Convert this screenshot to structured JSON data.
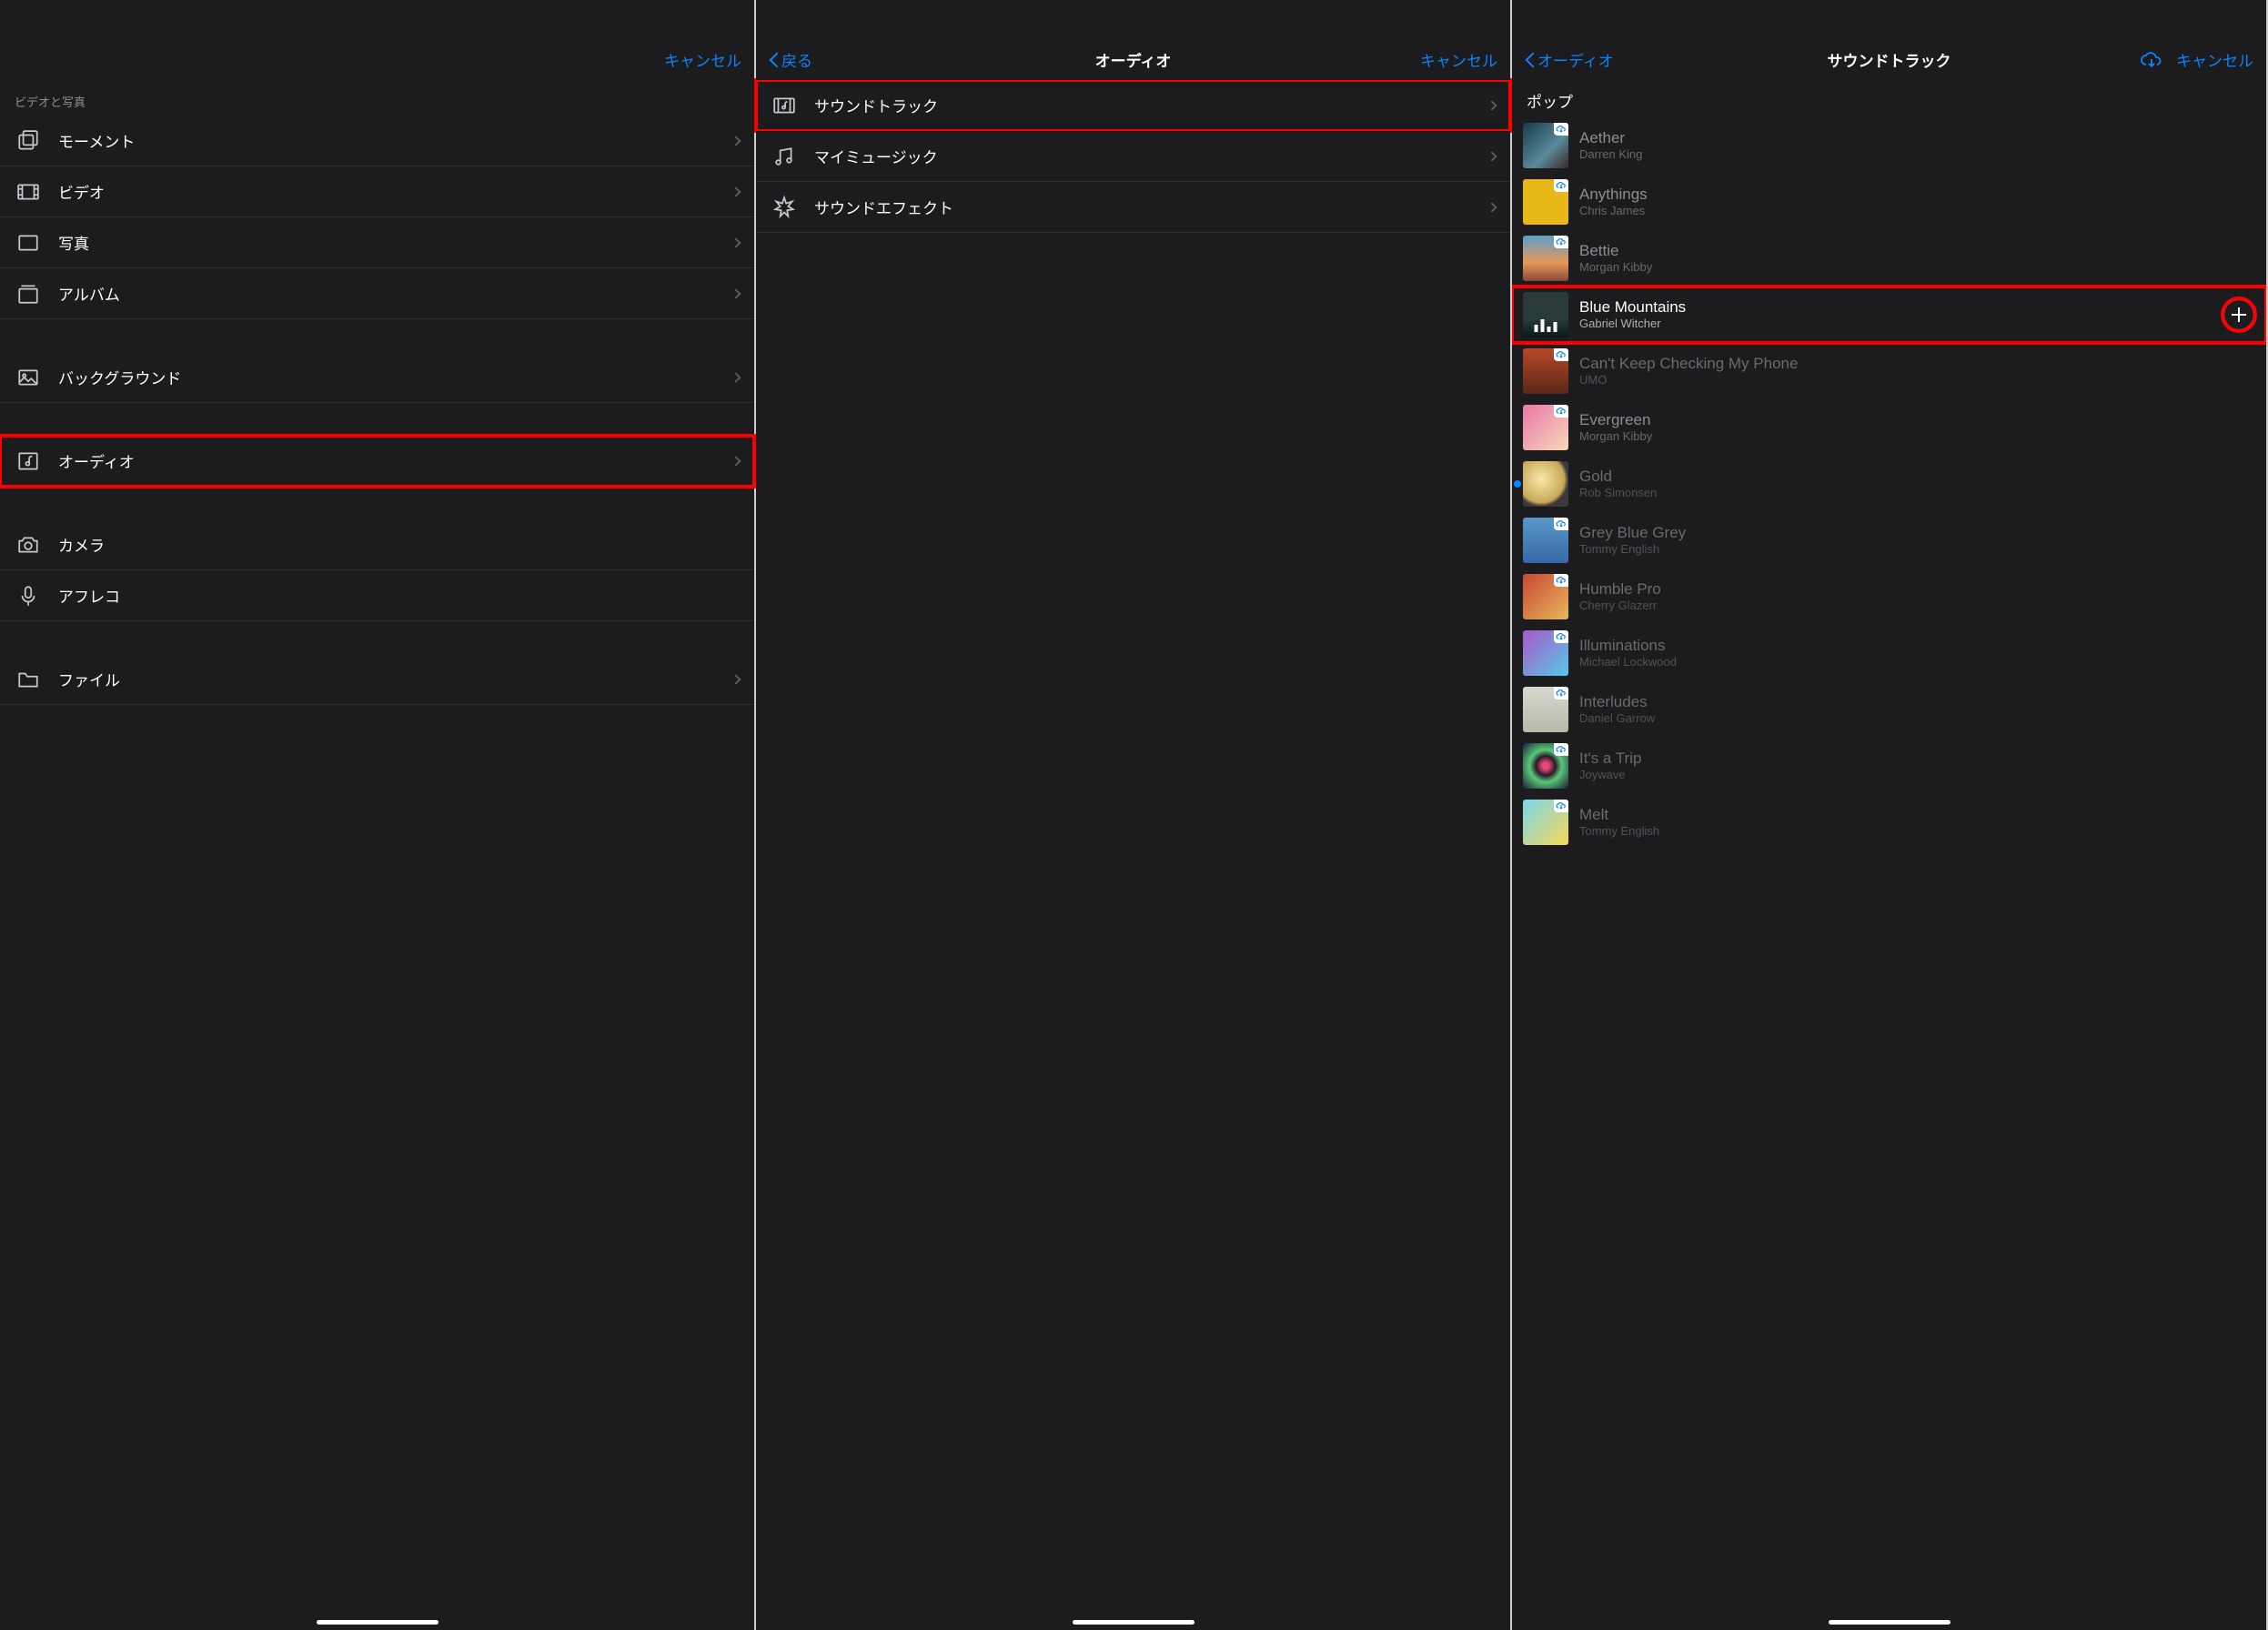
{
  "panel1": {
    "cancel": "キャンセル",
    "section_video_photo": "ビデオと写真",
    "rows": {
      "moments": "モーメント",
      "video": "ビデオ",
      "photo": "写真",
      "album": "アルバム",
      "background": "バックグラウンド",
      "audio": "オーディオ",
      "camera": "カメラ",
      "voiceover": "アフレコ",
      "files": "ファイル"
    }
  },
  "panel2": {
    "back": "戻る",
    "title": "オーディオ",
    "cancel": "キャンセル",
    "rows": {
      "soundtrack": "サウンドトラック",
      "mymusic": "マイミュージック",
      "sfx": "サウンドエフェクト"
    }
  },
  "panel3": {
    "back": "オーディオ",
    "title": "サウンドトラック",
    "cancel": "キャンセル",
    "genre": "ポップ",
    "tracks": [
      {
        "title": "Aether",
        "artist": "Darren King",
        "art": "art-aether",
        "cloud": true
      },
      {
        "title": "Anythings",
        "artist": "Chris James",
        "art": "art-anythings",
        "cloud": true
      },
      {
        "title": "Bettie",
        "artist": "Morgan Kibby",
        "art": "art-bettie",
        "cloud": true
      },
      {
        "title": "Blue Mountains",
        "artist": "Gabriel Witcher",
        "art": "art-bluemtn",
        "active": true,
        "add": true,
        "highlight": true
      },
      {
        "title": "Can't Keep Checking My Phone",
        "artist": "UMO",
        "art": "art-cant",
        "cloud": true,
        "dim": true
      },
      {
        "title": "Evergreen",
        "artist": "Morgan Kibby",
        "art": "art-ever",
        "cloud": true
      },
      {
        "title": "Gold",
        "artist": "Rob Simonsen",
        "art": "art-gold",
        "dot": true,
        "dim": true
      },
      {
        "title": "Grey Blue Grey",
        "artist": "Tommy English",
        "art": "art-grey",
        "cloud": true,
        "dim": true
      },
      {
        "title": "Humble Pro",
        "artist": "Cherry Glazerr",
        "art": "art-humble",
        "cloud": true,
        "dim": true
      },
      {
        "title": "Illuminations",
        "artist": "Michael Lockwood",
        "art": "art-illum",
        "cloud": true,
        "dim": true
      },
      {
        "title": "Interludes",
        "artist": "Daniel Garrow",
        "art": "art-inter",
        "cloud": true,
        "dim": true
      },
      {
        "title": "It's a Trip",
        "artist": "Joywave",
        "art": "art-trip",
        "cloud": true,
        "dim": true
      },
      {
        "title": "Melt",
        "artist": "Tommy English",
        "art": "art-melt",
        "cloud": true,
        "dim": true
      }
    ]
  }
}
